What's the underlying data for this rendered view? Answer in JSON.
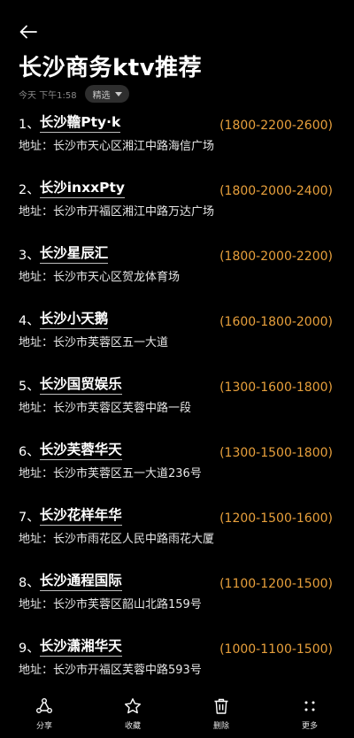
{
  "header": {
    "title": "长沙商务ktv推荐",
    "meta_time": "今天 下午1:58",
    "filter_label": "精选"
  },
  "colors": {
    "background": "#000000",
    "price": "#e8a03c",
    "text": "#ffffff",
    "muted": "#8a8a8a"
  },
  "items": [
    {
      "num": "1、",
      "name": "长沙韂Pty·k",
      "price": "(1800-2200-2600)",
      "addr": "地址：长沙市天心区湘江中路海信广场"
    },
    {
      "num": "2、",
      "name": "长沙inxxPty",
      "price": "(1800-2000-2400)",
      "addr": "地址：长沙市开福区湘江中路万达广场"
    },
    {
      "num": "3、",
      "name": "长沙星辰汇",
      "price": "(1800-2000-2200)",
      "addr": "地址：长沙市天心区贺龙体育场"
    },
    {
      "num": "4、",
      "name": "长沙小天鹅",
      "price": "(1600-1800-2000)",
      "addr": "地址：长沙市芙蓉区五一大道"
    },
    {
      "num": "5、",
      "name": "长沙国贸娱乐",
      "price": "(1300-1600-1800)",
      "addr": "地址：长沙市芙蓉区芙蓉中路一段"
    },
    {
      "num": "6、",
      "name": "长沙芙蓉华天",
      "price": "(1300-1500-1800)",
      "addr": "地址：长沙市芙蓉区五一大道236号"
    },
    {
      "num": "7、",
      "name": "长沙花样年华",
      "price": "(1200-1500-1600)",
      "addr": "地址：长沙市雨花区人民中路雨花大厦"
    },
    {
      "num": "8、",
      "name": "长沙通程国际",
      "price": "(1100-1200-1500)",
      "addr": "地址：长沙市芙蓉区韶山北路159号"
    },
    {
      "num": "9、",
      "name": "长沙潇湘华天",
      "price": "(1000-1100-1500)",
      "addr": "地址：长沙市开福区芙蓉中路593号"
    }
  ],
  "toolbar": {
    "share": {
      "label": "分享",
      "icon": "share-icon"
    },
    "favorite": {
      "label": "收藏",
      "icon": "star-icon"
    },
    "delete": {
      "label": "删除",
      "icon": "trash-icon"
    },
    "more": {
      "label": "更多",
      "icon": "more-icon"
    }
  }
}
